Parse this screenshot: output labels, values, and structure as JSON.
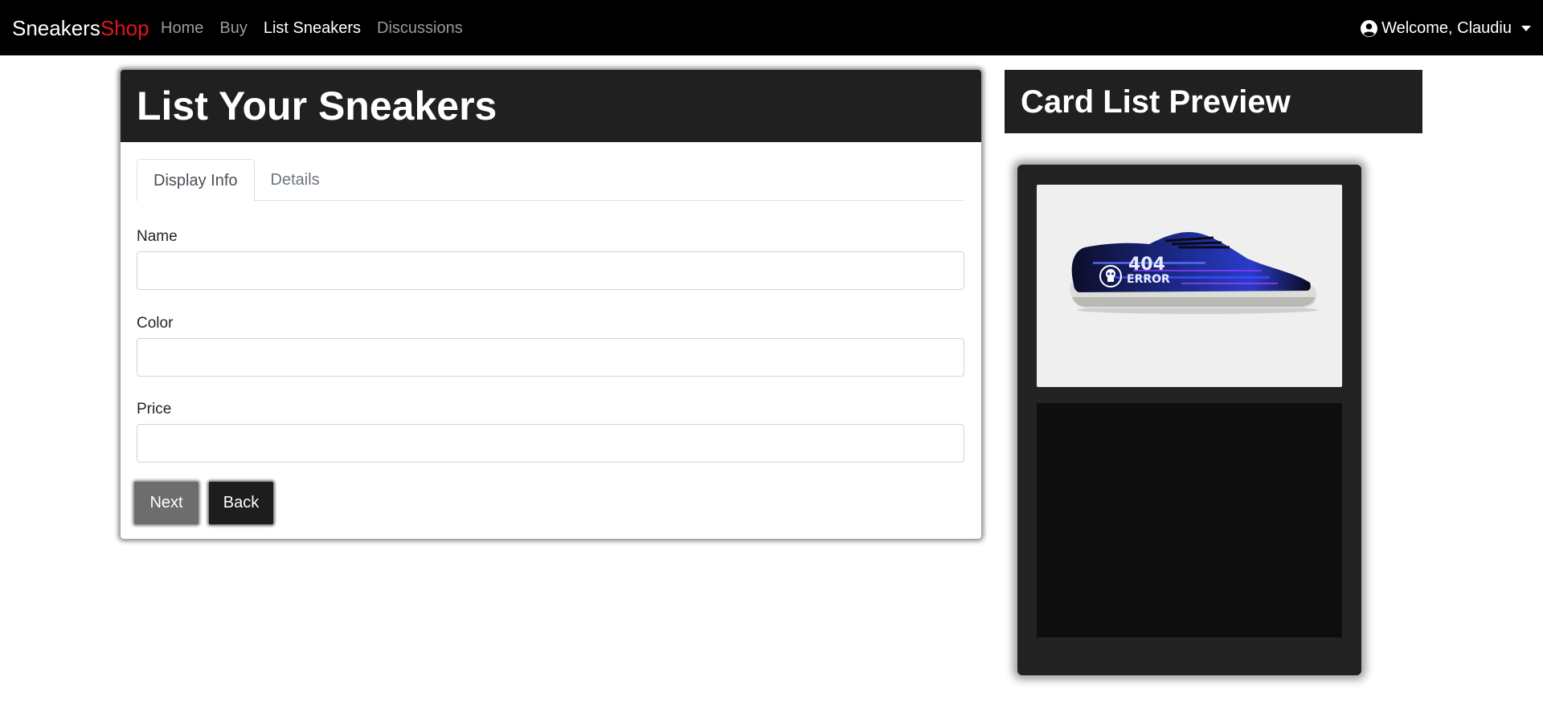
{
  "navbar": {
    "brand_primary": "Sneakers",
    "brand_accent": "Shop",
    "brand_accent_color": "#e4141c",
    "links": [
      {
        "label": "Home",
        "active": false
      },
      {
        "label": "Buy",
        "active": false
      },
      {
        "label": "List Sneakers",
        "active": true
      },
      {
        "label": "Discussions",
        "active": false
      }
    ],
    "user": {
      "icon": "user-circle-icon",
      "label": "Welcome, Claudiu",
      "dropdown_icon": "caret-down-icon"
    }
  },
  "form": {
    "title": "List Your Sneakers",
    "tabs": [
      {
        "label": "Display Info",
        "active": true
      },
      {
        "label": "Details",
        "active": false
      }
    ],
    "fields": {
      "name": {
        "label": "Name",
        "value": "",
        "placeholder": ""
      },
      "color": {
        "label": "Color",
        "value": "",
        "placeholder": ""
      },
      "price": {
        "label": "Price",
        "value": "",
        "placeholder": ""
      }
    },
    "buttons": {
      "next": "Next",
      "back": "Back"
    }
  },
  "preview": {
    "title": "Card List Preview",
    "image": {
      "subject": "sneaker-404-error-image",
      "shoe_text_line1": "404",
      "shoe_text_line2": "ERROR"
    }
  }
}
